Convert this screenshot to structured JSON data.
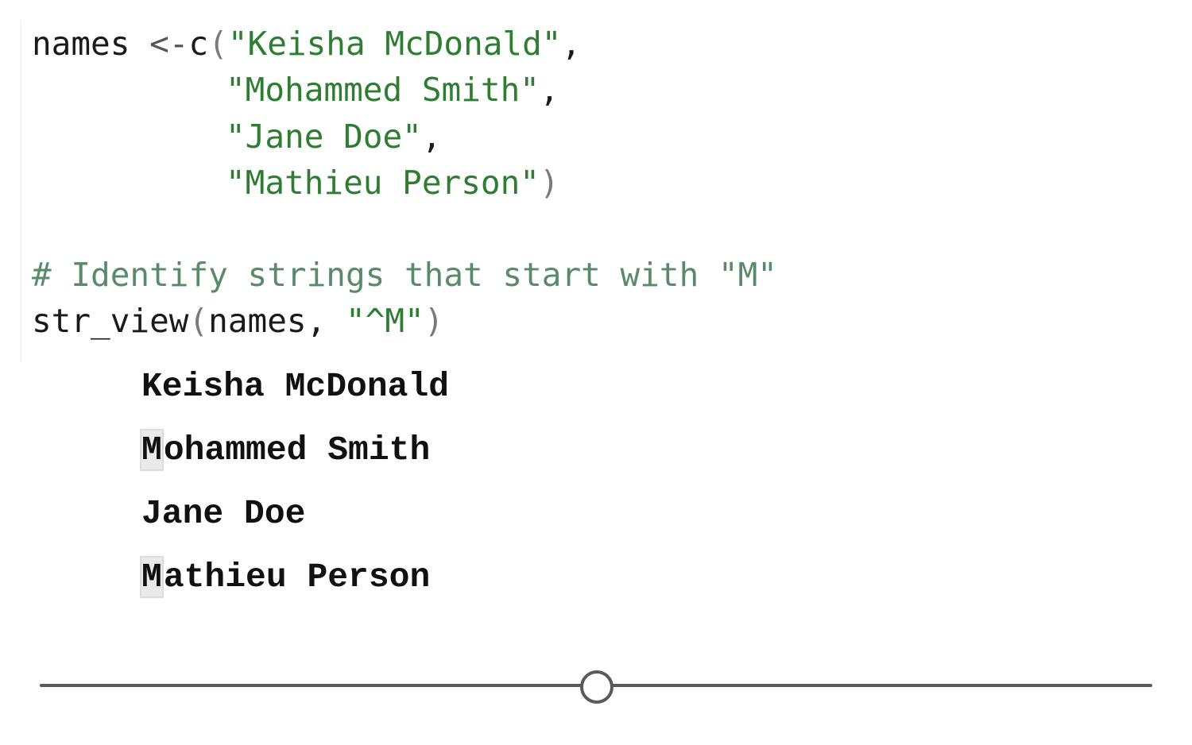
{
  "code": {
    "line1": {
      "var": "names",
      "assign": " <-",
      "fn": "c",
      "open_paren": "(",
      "str": "\"Keisha McDonald\"",
      "comma": ","
    },
    "line2": {
      "str": "\"Mohammed Smith\"",
      "comma": ","
    },
    "line3": {
      "str": "\"Jane Doe\"",
      "comma": ","
    },
    "line4": {
      "str": "\"Mathieu Person\"",
      "close_paren": ")"
    },
    "comment": "# Identify strings that start with \"M\"",
    "call": {
      "fn": "str_view",
      "open_paren": "(",
      "arg": "names, ",
      "pattern": "\"^M\"",
      "close_paren": ")"
    }
  },
  "output": {
    "items": [
      {
        "match": "",
        "rest": "Keisha McDonald"
      },
      {
        "match": "M",
        "rest": "ohammed Smith"
      },
      {
        "match": "",
        "rest": "Jane Doe"
      },
      {
        "match": "M",
        "rest": "athieu Person"
      }
    ]
  },
  "slider": {
    "value_fraction": 0.5
  },
  "colors": {
    "string": "#2e7d32",
    "comment": "#5a8a6a",
    "match_highlight": "#eaeaea"
  }
}
